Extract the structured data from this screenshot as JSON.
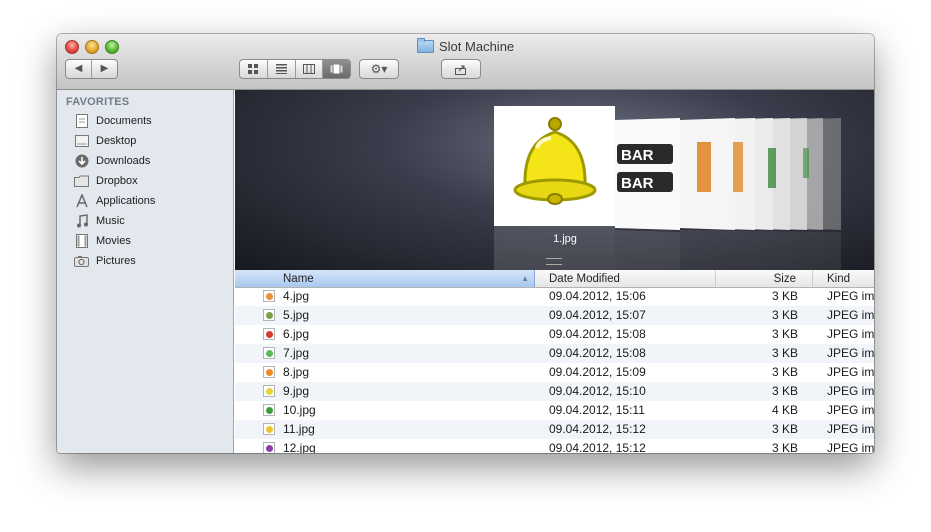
{
  "window": {
    "title": "Slot Machine"
  },
  "toolbar": {
    "nav_back": "◀",
    "nav_forward": "▶",
    "action_glyph": "⚙▾",
    "share_glyph": "⇪"
  },
  "sidebar": {
    "header": "FAVORITES",
    "items": [
      {
        "label": "Documents",
        "icon": "documents-icon"
      },
      {
        "label": "Desktop",
        "icon": "desktop-icon"
      },
      {
        "label": "Downloads",
        "icon": "downloads-icon"
      },
      {
        "label": "Dropbox",
        "icon": "dropbox-folder-icon"
      },
      {
        "label": "Applications",
        "icon": "applications-icon"
      },
      {
        "label": "Music",
        "icon": "music-icon"
      },
      {
        "label": "Movies",
        "icon": "movies-icon"
      },
      {
        "label": "Pictures",
        "icon": "pictures-icon"
      }
    ]
  },
  "coverflow": {
    "selected_caption": "1.jpg"
  },
  "columns": {
    "name": "Name",
    "date": "Date Modified",
    "size": "Size",
    "kind": "Kind"
  },
  "files": [
    {
      "name": "4.jpg",
      "date": "09.04.2012, 15:06",
      "size": "3 KB",
      "kind": "JPEG ima",
      "color": "#e8933a"
    },
    {
      "name": "5.jpg",
      "date": "09.04.2012, 15:07",
      "size": "3 KB",
      "kind": "JPEG ima",
      "color": "#7aa04a"
    },
    {
      "name": "6.jpg",
      "date": "09.04.2012, 15:08",
      "size": "3 KB",
      "kind": "JPEG ima",
      "color": "#d23a2e"
    },
    {
      "name": "7.jpg",
      "date": "09.04.2012, 15:08",
      "size": "3 KB",
      "kind": "JPEG ima",
      "color": "#5cb85c"
    },
    {
      "name": "8.jpg",
      "date": "09.04.2012, 15:09",
      "size": "3 KB",
      "kind": "JPEG ima",
      "color": "#f08a24"
    },
    {
      "name": "9.jpg",
      "date": "09.04.2012, 15:10",
      "size": "3 KB",
      "kind": "JPEG ima",
      "color": "#e7d33a"
    },
    {
      "name": "10.jpg",
      "date": "09.04.2012, 15:11",
      "size": "4 KB",
      "kind": "JPEG ima",
      "color": "#3f9e3f"
    },
    {
      "name": "11.jpg",
      "date": "09.04.2012, 15:12",
      "size": "3 KB",
      "kind": "JPEG ima",
      "color": "#e8c52a"
    },
    {
      "name": "12.jpg",
      "date": "09.04.2012, 15:12",
      "size": "3 KB",
      "kind": "JPEG ima",
      "color": "#8a3fa8"
    }
  ]
}
